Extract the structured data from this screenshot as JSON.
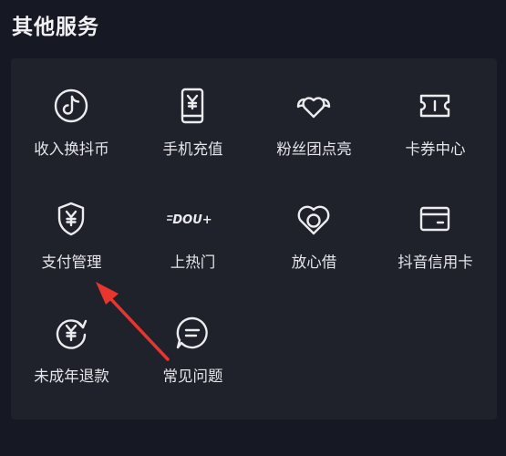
{
  "section": {
    "title": "其他服务"
  },
  "services": [
    {
      "label": "收入换抖币",
      "icon": "douyin-logo-icon"
    },
    {
      "label": "手机充值",
      "icon": "phone-yen-icon"
    },
    {
      "label": "粉丝团点亮",
      "icon": "winged-heart-icon"
    },
    {
      "label": "卡券中心",
      "icon": "ticket-icon"
    },
    {
      "label": "支付管理",
      "icon": "shield-yen-icon"
    },
    {
      "label": "上热门",
      "icon": "dou-plus-icon"
    },
    {
      "label": "放心借",
      "icon": "heart-coin-icon"
    },
    {
      "label": "抖音信用卡",
      "icon": "credit-card-icon"
    },
    {
      "label": "未成年退款",
      "icon": "refund-yen-icon"
    },
    {
      "label": "常见问题",
      "icon": "chat-bubble-icon"
    }
  ],
  "douplus_logo_text": "DOU+",
  "colors": {
    "background": "#161823",
    "panel": "#1f212b",
    "icon": "#ececef",
    "annotation_arrow": "#e8352e"
  }
}
